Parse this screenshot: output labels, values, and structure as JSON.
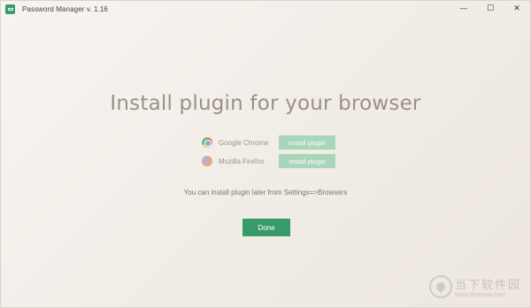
{
  "window": {
    "title": "Password Manager v. 1.16",
    "controls": {
      "minimize": "—",
      "maximize": "☐",
      "close": "✕"
    }
  },
  "main": {
    "headline": "Install plugin for your browser",
    "browsers": [
      {
        "name": "Google Chrome",
        "icon": "chrome-icon",
        "button": "Install plugin"
      },
      {
        "name": "Mozilla Firefox",
        "icon": "firefox-icon",
        "button": "Install plugin"
      }
    ],
    "note": "You can install plugin later from Settings=>Browsers",
    "done_label": "Done"
  },
  "watermark": {
    "cn": "当下软件园",
    "url": "www.downxia.com"
  },
  "colors": {
    "accent": "#3a9b6a",
    "install_button": "#a9d5b9",
    "headline": "#9a9182"
  }
}
